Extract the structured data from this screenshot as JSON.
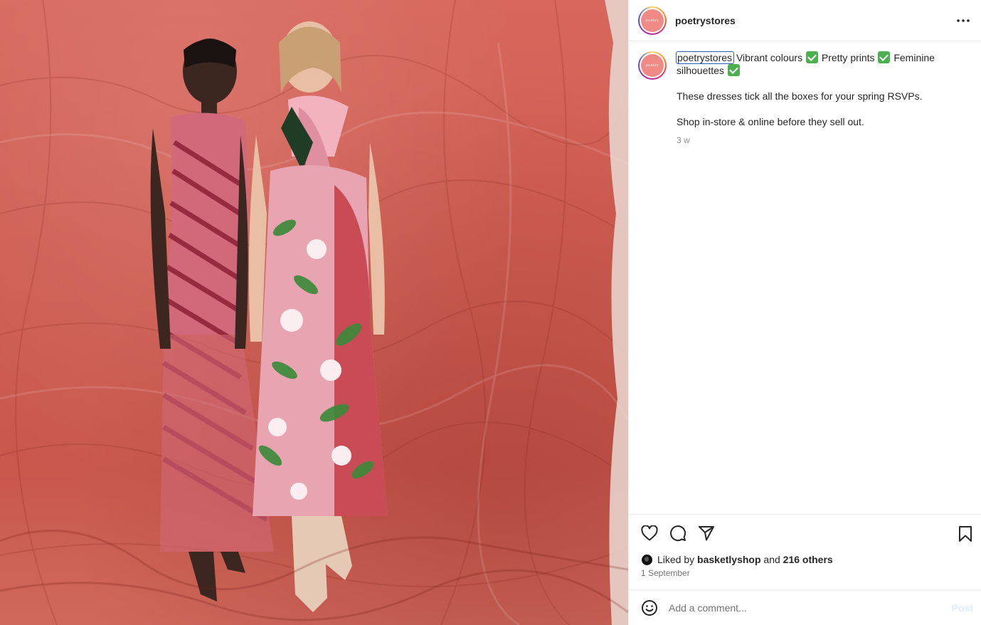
{
  "post": {
    "username": "poetrystores",
    "avatar_text": "poetry",
    "image_alt": "",
    "caption": {
      "username": "poetrystores",
      "line1_a": "Vibrant colours",
      "line1_b": "Pretty prints",
      "line1_c": "Feminine silhouettes",
      "para2": "These dresses tick all the boxes for your spring RSVPs.",
      "para3": "Shop in-store & online before they sell out.",
      "time": "3 w"
    },
    "likes": {
      "prefix": "Liked by",
      "user": "basketlyshop",
      "joiner": "and",
      "others": "216 others"
    },
    "date": "1 September",
    "comment": {
      "placeholder": "Add a comment...",
      "post_label": "Post"
    }
  },
  "icons": {
    "more": "more-horizontal-icon",
    "like": "heart-icon",
    "comment": "comment-icon",
    "share": "send-icon",
    "save": "bookmark-icon",
    "emoji": "emoji-icon",
    "check": "check-mark-icon"
  },
  "colors": {
    "backdrop": "#d0614f",
    "check_green": "#4caf50",
    "focus_outline": "#2f5fb3",
    "post_disabled": "#e0ecf9"
  }
}
